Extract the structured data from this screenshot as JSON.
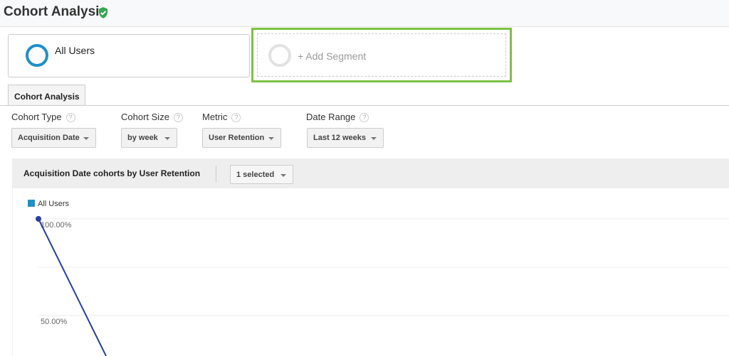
{
  "header": {
    "title": "Cohort Analysis",
    "verified_icon": "shield-check-icon"
  },
  "segments": {
    "active": "All Users",
    "add": "+ Add Segment"
  },
  "tab": {
    "label": "Cohort Analysis"
  },
  "filters": [
    {
      "label": "Cohort Type",
      "value": "Acquisition Date"
    },
    {
      "label": "Cohort Size",
      "value": "by week"
    },
    {
      "label": "Metric",
      "value": "User Retention"
    },
    {
      "label": "Date Range",
      "value": "Last 12 weeks"
    }
  ],
  "help_glyph": "?",
  "chart_bar": {
    "title": "Acquisition Date cohorts by User Retention",
    "selector": "1 selected"
  },
  "colors": {
    "accent": "#1e90c8",
    "line": "#2440a8",
    "highlight": "#7cc242"
  },
  "chart_data": {
    "type": "line",
    "legend": [
      "All Users"
    ],
    "legend_placement": "top-left",
    "yticks": [
      "100.00%",
      "50.00%"
    ],
    "ylim": [
      0,
      100
    ],
    "grid": true,
    "series": [
      {
        "name": "All Users",
        "values": [
          100
        ]
      }
    ]
  }
}
